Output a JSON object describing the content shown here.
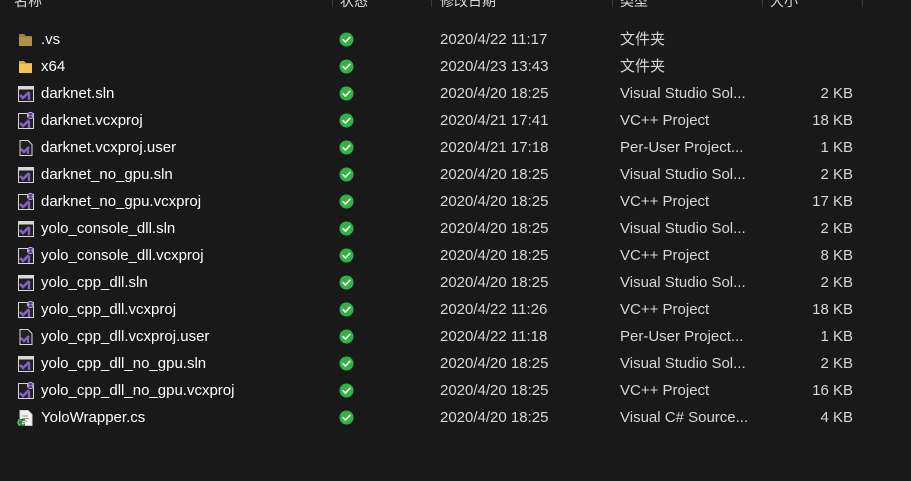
{
  "header": {
    "name": "名称",
    "status": "状态",
    "modified": "修改日期",
    "type": "类型",
    "size": "大小"
  },
  "colors": {
    "background": "#191919",
    "folder": "#e8b949",
    "vs_purple": "#8661c5",
    "status_green": "#2fb344"
  },
  "files": [
    {
      "name": ".vs",
      "icon": "folder-dark-icon",
      "date": "2020/4/22 11:17",
      "type": "文件夹",
      "size": ""
    },
    {
      "name": "x64",
      "icon": "folder-icon",
      "date": "2020/4/23 13:43",
      "type": "文件夹",
      "size": ""
    },
    {
      "name": "darknet.sln",
      "icon": "vs-solution-icon",
      "date": "2020/4/20 18:25",
      "type": "Visual Studio Sol...",
      "size": "2 KB"
    },
    {
      "name": "darknet.vcxproj",
      "icon": "vcxproj-icon",
      "date": "2020/4/21 17:41",
      "type": "VC++ Project",
      "size": "18 KB"
    },
    {
      "name": "darknet.vcxproj.user",
      "icon": "vs-user-file-icon",
      "date": "2020/4/21 17:18",
      "type": "Per-User Project...",
      "size": "1 KB"
    },
    {
      "name": "darknet_no_gpu.sln",
      "icon": "vs-solution-icon",
      "date": "2020/4/20 18:25",
      "type": "Visual Studio Sol...",
      "size": "2 KB"
    },
    {
      "name": "darknet_no_gpu.vcxproj",
      "icon": "vcxproj-icon",
      "date": "2020/4/20 18:25",
      "type": "VC++ Project",
      "size": "17 KB"
    },
    {
      "name": "yolo_console_dll.sln",
      "icon": "vs-solution-icon",
      "date": "2020/4/20 18:25",
      "type": "Visual Studio Sol...",
      "size": "2 KB"
    },
    {
      "name": "yolo_console_dll.vcxproj",
      "icon": "vcxproj-icon",
      "date": "2020/4/20 18:25",
      "type": "VC++ Project",
      "size": "8 KB"
    },
    {
      "name": "yolo_cpp_dll.sln",
      "icon": "vs-solution-icon",
      "date": "2020/4/20 18:25",
      "type": "Visual Studio Sol...",
      "size": "2 KB"
    },
    {
      "name": "yolo_cpp_dll.vcxproj",
      "icon": "vcxproj-icon",
      "date": "2020/4/22 11:26",
      "type": "VC++ Project",
      "size": "18 KB"
    },
    {
      "name": "yolo_cpp_dll.vcxproj.user",
      "icon": "vs-user-file-icon",
      "date": "2020/4/22 11:18",
      "type": "Per-User Project...",
      "size": "1 KB"
    },
    {
      "name": "yolo_cpp_dll_no_gpu.sln",
      "icon": "vs-solution-icon",
      "date": "2020/4/20 18:25",
      "type": "Visual Studio Sol...",
      "size": "2 KB"
    },
    {
      "name": "yolo_cpp_dll_no_gpu.vcxproj",
      "icon": "vcxproj-icon",
      "date": "2020/4/20 18:25",
      "type": "VC++ Project",
      "size": "16 KB"
    },
    {
      "name": "YoloWrapper.cs",
      "icon": "csharp-file-icon",
      "date": "2020/4/20 18:25",
      "type": "Visual C# Source...",
      "size": "4 KB"
    }
  ]
}
